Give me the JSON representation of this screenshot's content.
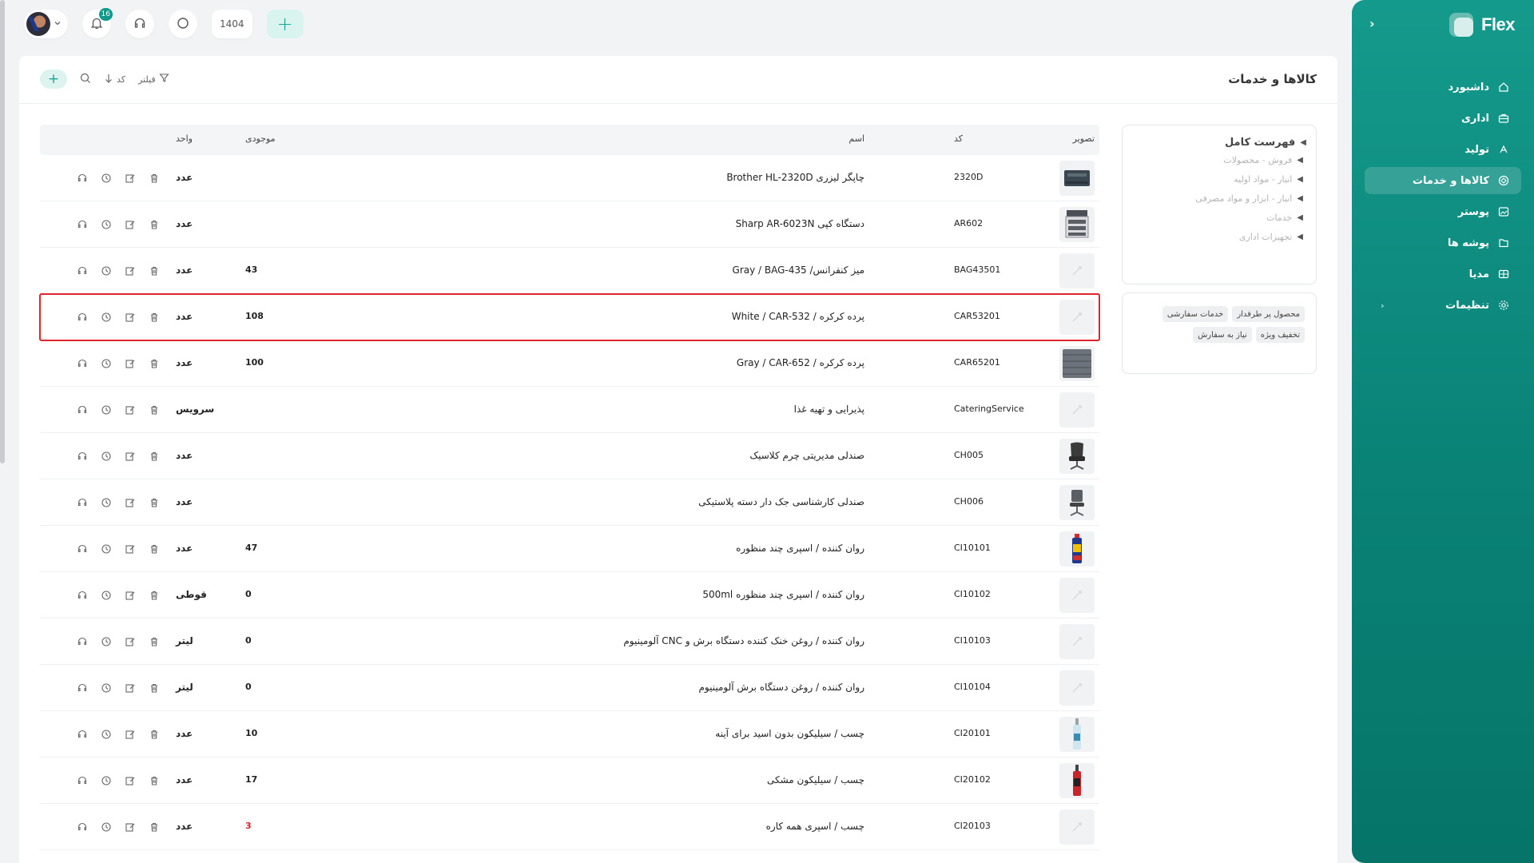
{
  "app": {
    "name": "Flex",
    "page_title": "کالاها و خدمات"
  },
  "sidebar": {
    "items": [
      {
        "label": "داشبورد",
        "icon": "home-icon"
      },
      {
        "label": "اداری",
        "icon": "briefcase-icon"
      },
      {
        "label": "تولید",
        "icon": "production-icon"
      },
      {
        "label": "کالاها و خدمات",
        "icon": "box-icon",
        "active": true
      },
      {
        "label": "پوستر",
        "icon": "poster-icon"
      },
      {
        "label": "پوشه ها",
        "icon": "folder-icon"
      },
      {
        "label": "مدیا",
        "icon": "media-icon"
      },
      {
        "label": "تنظیمات",
        "icon": "gear-icon",
        "expandable": true
      }
    ]
  },
  "topbar": {
    "notification_count": "16",
    "year": "1404"
  },
  "toolbar": {
    "filter_label": "فیلتر",
    "sort_label": "کد"
  },
  "categories": {
    "root": "فهرست کامل",
    "children": [
      "فروش - محصولات",
      "انبار - مواد اولیه",
      "انبار - ابزار و مواد مصرفی",
      "خدمات",
      "تجهیزات اداری"
    ]
  },
  "tags": [
    "محصول پر طرفدار",
    "خدمات سفارشی",
    "تخفیف ویژه",
    "نیاز به سفارش"
  ],
  "table": {
    "headers": {
      "image": "تصویر",
      "code": "کد",
      "name": "اسم",
      "stock": "موجودی",
      "unit": "واحد"
    },
    "rows": [
      {
        "code": "2320D",
        "name": "چاپگر لیزری Brother HL-2320D",
        "stock": "",
        "unit": "عدد",
        "thumb": "printer"
      },
      {
        "code": "AR602",
        "name": "دستگاه کپی Sharp AR-6023N",
        "stock": "",
        "unit": "عدد",
        "thumb": "copier"
      },
      {
        "code": "BAG43501",
        "name": "میز کنفرانس/ Gray / BAG-435",
        "stock": "43",
        "unit": "عدد",
        "thumb": "placeholder"
      },
      {
        "code": "CAR53201",
        "name": "پرده کرکره / White / CAR-532",
        "stock": "108",
        "unit": "عدد",
        "thumb": "placeholder",
        "selected": true
      },
      {
        "code": "CAR65201",
        "name": "پرده کرکره / Gray / CAR-652",
        "stock": "100",
        "unit": "عدد",
        "thumb": "fabric"
      },
      {
        "code": "CateringService",
        "name": "پذیرایی و تهیه غذا",
        "stock": "",
        "unit": "سرویس",
        "thumb": "placeholder"
      },
      {
        "code": "CH005",
        "name": "صندلی مدیریتی چرم کلاسیک",
        "stock": "",
        "unit": "عدد",
        "thumb": "chair"
      },
      {
        "code": "CH006",
        "name": "صندلی کارشناسی جک دار دسته پلاستیکی",
        "stock": "",
        "unit": "عدد",
        "thumb": "chair2"
      },
      {
        "code": "CI10101",
        "name": "روان کننده / اسپری چند منظوره",
        "stock": "47",
        "unit": "عدد",
        "thumb": "spray"
      },
      {
        "code": "CI10102",
        "name": "روان کننده / اسپری چند منظوره 500ml",
        "stock": "0",
        "unit": "قوطی",
        "thumb": "placeholder"
      },
      {
        "code": "CI10103",
        "name": "روان کننده / روغن خنک کننده دستگاه برش و CNC آلومینیوم",
        "stock": "0",
        "unit": "لیتر",
        "thumb": "placeholder"
      },
      {
        "code": "CI10104",
        "name": "روان کننده / روغن دستگاه برش آلومینیوم",
        "stock": "0",
        "unit": "لیتر",
        "thumb": "placeholder"
      },
      {
        "code": "CI20101",
        "name": "چسب / سیلیکون بدون اسید برای آینه",
        "stock": "10",
        "unit": "عدد",
        "thumb": "tube"
      },
      {
        "code": "CI20102",
        "name": "چسب / سیلیکون مشکی",
        "stock": "17",
        "unit": "عدد",
        "thumb": "tube-red"
      },
      {
        "code": "CI20103",
        "name": "چسب / اسپری همه کاره",
        "stock": "3",
        "unit": "عدد",
        "thumb": "placeholder",
        "stock_alert": true
      }
    ]
  },
  "colors": {
    "accent": "#0f9a8b",
    "selection": "#e0242b",
    "alert": "#d81e2a"
  }
}
